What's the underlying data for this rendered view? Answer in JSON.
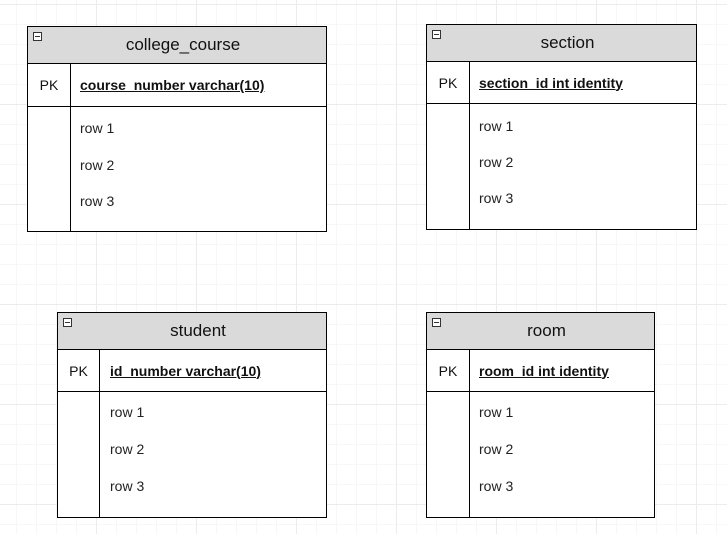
{
  "entities": {
    "college_course": {
      "title": "college_course",
      "key_label": "PK",
      "pk_field": "course_number varchar(10)",
      "rows": [
        "row 1",
        "row 2",
        "row 3"
      ]
    },
    "section": {
      "title": "section",
      "key_label": "PK",
      "pk_field": "section_id int identity",
      "rows": [
        "row 1",
        "row 2",
        "row 3"
      ]
    },
    "student": {
      "title": "student",
      "key_label": "PK",
      "pk_field": "id_number varchar(10)",
      "rows": [
        "row 1",
        "row 2",
        "row 3"
      ]
    },
    "room": {
      "title": "room",
      "key_label": "PK",
      "pk_field": "room_id int identity",
      "rows": [
        "row 1",
        "row 2",
        "row 3"
      ]
    }
  }
}
